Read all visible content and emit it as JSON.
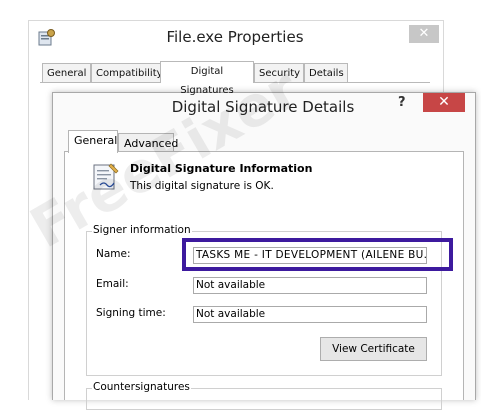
{
  "parent_window": {
    "title": "File.exe Properties",
    "close_glyph": "✕",
    "icon": "properties-icon",
    "tabs": [
      "General",
      "Compatibility",
      "Digital Signatures",
      "Security",
      "Details"
    ],
    "active_tab": "Digital Signatures"
  },
  "dialog": {
    "title": "Digital Signature Details",
    "help_glyph": "?",
    "close_glyph": "✕",
    "tabs": [
      "General",
      "Advanced"
    ],
    "active_tab": "General",
    "info": {
      "icon": "certificate-icon",
      "title": "Digital Signature Information",
      "subtitle": "This digital signature is OK."
    },
    "signer": {
      "group_label": "Signer information",
      "name_label": "Name:",
      "name_value": "TASKS ME - IT DEVELOPMENT (AILENE BU..",
      "email_label": "Email:",
      "email_value": "Not available",
      "time_label": "Signing time:",
      "time_value": "Not available",
      "view_button": "View Certificate"
    },
    "countersignatures": {
      "group_label": "Countersignatures"
    }
  },
  "watermark": "FreeFixer",
  "colors": {
    "highlight_border": "#3d1a9e",
    "dialog_close_bg": "#c74646"
  }
}
